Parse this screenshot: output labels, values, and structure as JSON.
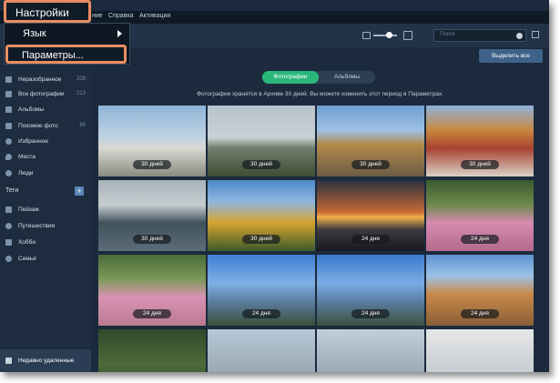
{
  "menubar": {
    "items": [
      "Справка",
      "Активация"
    ],
    "partial": "ние"
  },
  "settings_menu": {
    "label": "Настройки",
    "items": [
      "Язык",
      "Параметры..."
    ]
  },
  "search": {
    "placeholder": "Поиск"
  },
  "sidebar": {
    "items": [
      {
        "label": "Неразобранное",
        "count": "209",
        "icon": "unsorted-icon"
      },
      {
        "label": "Все фотографии",
        "count": "213",
        "icon": "all-photos-icon"
      },
      {
        "label": "Альбомы",
        "count": "",
        "icon": "albums-icon"
      },
      {
        "label": "Похожие фото",
        "count": "99",
        "icon": "similar-photos-icon"
      },
      {
        "label": "Избранное",
        "count": "",
        "icon": "heart-icon"
      },
      {
        "label": "Места",
        "count": "",
        "icon": "location-icon"
      },
      {
        "label": "Люди",
        "count": "",
        "icon": "people-icon"
      }
    ],
    "tags_header": "Теги",
    "tags": [
      {
        "label": "Пейзаж",
        "icon": "tag-icon"
      },
      {
        "label": "Путешествия",
        "icon": "globe-icon"
      },
      {
        "label": "Хобби",
        "icon": "plane-icon"
      },
      {
        "label": "Семья",
        "icon": "people-icon"
      }
    ],
    "deleted": "Недавно удаленные"
  },
  "main": {
    "select_all": "Выделить все",
    "tabs": [
      "Фотографии",
      "Альбомы"
    ],
    "notice": "Фотографии хранятся в Архиве 30 дней. Вы можете изменить этот период в Параметрах.",
    "photos": [
      {
        "label": "30 дней"
      },
      {
        "label": "30 дней"
      },
      {
        "label": "30 дней"
      },
      {
        "label": "30 дней"
      },
      {
        "label": "30 дней"
      },
      {
        "label": "30 дней"
      },
      {
        "label": "24 дня"
      },
      {
        "label": "24 дня"
      },
      {
        "label": "24 дня"
      },
      {
        "label": "24 дня"
      },
      {
        "label": "24 дня"
      },
      {
        "label": "24 дня"
      },
      {
        "label": ""
      },
      {
        "label": ""
      },
      {
        "label": ""
      },
      {
        "label": ""
      }
    ]
  },
  "colors": {
    "accent_green": "#2ab87a",
    "highlight_orange": "#e88d63",
    "button_blue": "#3f628a"
  }
}
